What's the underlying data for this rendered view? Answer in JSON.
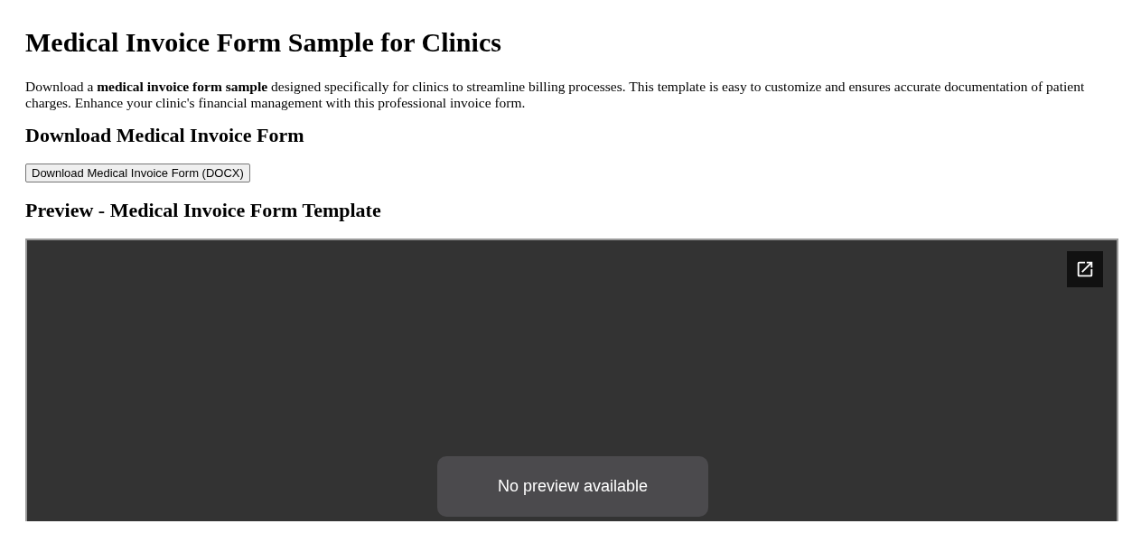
{
  "title": "Medical Invoice Form Sample for Clinics",
  "intro": "Download a **medical invoice form sample** designed specifically for clinics to streamline billing processes. This template is easy to customize and ensures accurate documentation of patient charges. Enhance your clinic's financial management with this professional invoice form.",
  "download_heading": "Download Medical Invoice Form",
  "download_button": "Download Medical Invoice Form (DOCX)",
  "preview_heading": "Preview - Medical Invoice Form Template",
  "preview": {
    "message": "No preview available"
  }
}
